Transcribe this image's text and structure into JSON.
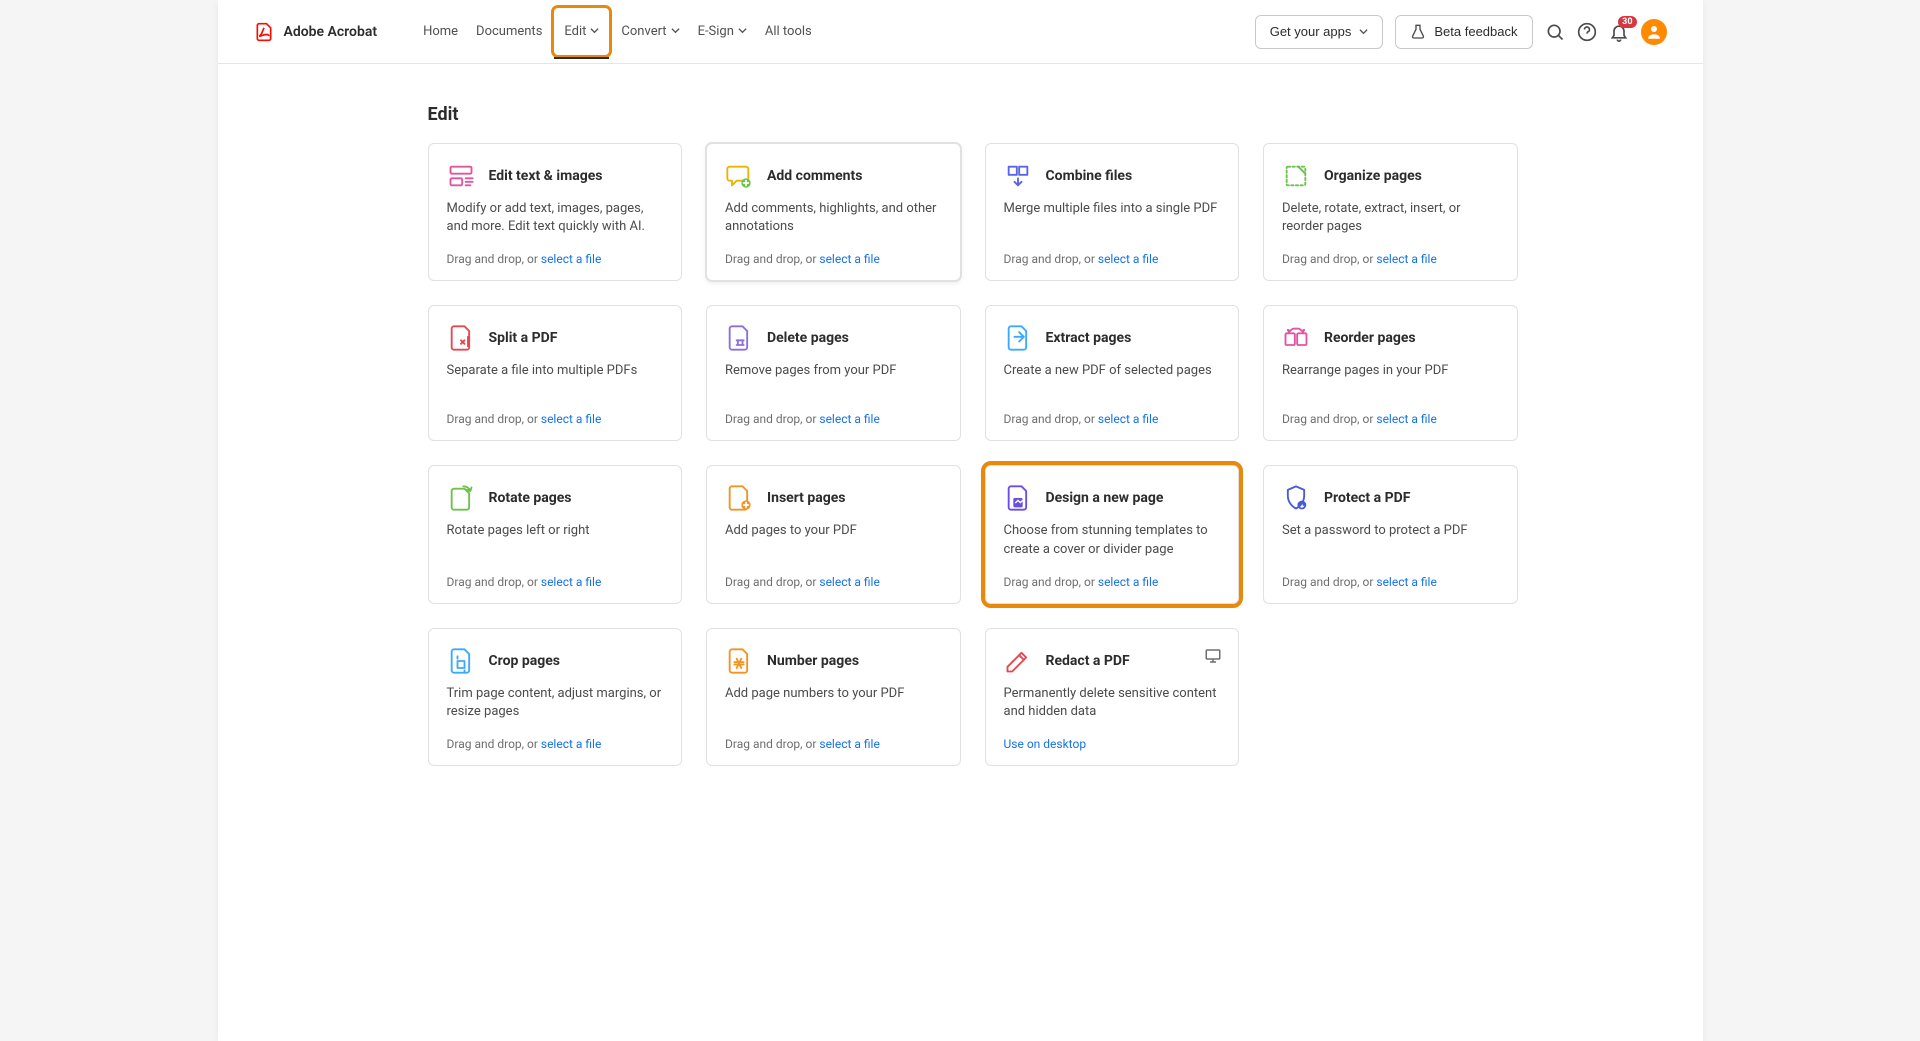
{
  "brand": {
    "name": "Adobe Acrobat"
  },
  "nav": {
    "items": [
      {
        "label": "Home",
        "hasChevron": false
      },
      {
        "label": "Documents",
        "hasChevron": false
      },
      {
        "label": "Edit",
        "hasChevron": true,
        "activeHighlight": true
      },
      {
        "label": "Convert",
        "hasChevron": true
      },
      {
        "label": "E-Sign",
        "hasChevron": true
      },
      {
        "label": "All tools",
        "hasChevron": false
      }
    ]
  },
  "headerRight": {
    "getApps": "Get your apps",
    "betaFeedback": "Beta feedback",
    "notifCount": "30"
  },
  "page": {
    "title": "Edit"
  },
  "dragText": "Drag and drop, or ",
  "selectFile": "select a file",
  "useOnDesktop": "Use on desktop",
  "cards": [
    {
      "id": "edit-text-images",
      "title": "Edit text & images",
      "desc": "Modify or add text, images, pages, and more. Edit text quickly with AI.",
      "footer": "drag",
      "icon": "edit-text",
      "selected": false
    },
    {
      "id": "add-comments",
      "title": "Add comments",
      "desc": "Add comments, highlights, and other annotations",
      "footer": "drag",
      "icon": "comments",
      "selected": true
    },
    {
      "id": "combine-files",
      "title": "Combine files",
      "desc": "Merge multiple files into a single PDF",
      "footer": "drag",
      "icon": "combine"
    },
    {
      "id": "organize-pages",
      "title": "Organize pages",
      "desc": "Delete, rotate, extract, insert, or reorder pages",
      "footer": "drag",
      "icon": "organize"
    },
    {
      "id": "split-pdf",
      "title": "Split a PDF",
      "desc": "Separate a file into multiple PDFs",
      "footer": "drag",
      "icon": "split"
    },
    {
      "id": "delete-pages",
      "title": "Delete pages",
      "desc": "Remove pages from your PDF",
      "footer": "drag",
      "icon": "delete"
    },
    {
      "id": "extract-pages",
      "title": "Extract pages",
      "desc": "Create a new PDF of selected pages",
      "footer": "drag",
      "icon": "extract"
    },
    {
      "id": "reorder-pages",
      "title": "Reorder pages",
      "desc": "Rearrange pages in your PDF",
      "footer": "drag",
      "icon": "reorder"
    },
    {
      "id": "rotate-pages",
      "title": "Rotate pages",
      "desc": "Rotate pages left or right",
      "footer": "drag",
      "icon": "rotate"
    },
    {
      "id": "insert-pages",
      "title": "Insert pages",
      "desc": "Add pages to your PDF",
      "footer": "drag",
      "icon": "insert"
    },
    {
      "id": "design-page",
      "title": "Design a new page",
      "desc": "Choose from stunning templates to create a cover or divider page",
      "footer": "drag",
      "icon": "design",
      "highlight": true
    },
    {
      "id": "protect-pdf",
      "title": "Protect a PDF",
      "desc": "Set a password to protect a PDF",
      "footer": "drag",
      "icon": "protect"
    },
    {
      "id": "crop-pages",
      "title": "Crop pages",
      "desc": "Trim page content, adjust margins, or resize pages",
      "footer": "drag",
      "icon": "crop"
    },
    {
      "id": "number-pages",
      "title": "Number pages",
      "desc": "Add page numbers to your PDF",
      "footer": "drag",
      "icon": "number"
    },
    {
      "id": "redact-pdf",
      "title": "Redact a PDF",
      "desc": "Permanently delete sensitive content and hidden data",
      "footer": "desktop",
      "icon": "redact",
      "desktopBadge": true
    }
  ],
  "iconColors": {
    "edit-text": "#e055a0",
    "comments": "#e8b500",
    "combine": "#5b63e6",
    "organize": "#6cc24a",
    "split": "#e34850",
    "delete": "#8e6ed8",
    "extract": "#3da9fc",
    "reorder": "#e055a0",
    "rotate": "#6cc24a",
    "insert": "#f29423",
    "design": "#6a4ee0",
    "protect": "#4a5bd8",
    "crop": "#3da9fc",
    "number": "#f29423",
    "redact": "#e34850"
  }
}
